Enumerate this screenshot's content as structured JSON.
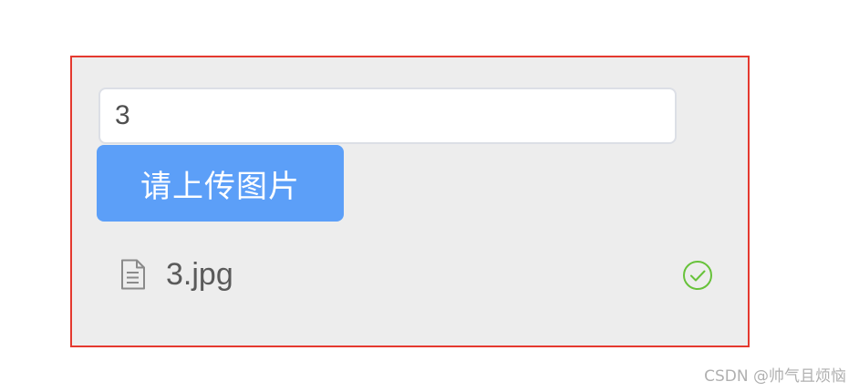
{
  "form": {
    "text_value": "3",
    "upload_button_label": "请上传图片",
    "file_list": [
      {
        "name": "3.jpg",
        "status_icon": "check-circle-icon",
        "status_color": "#67c23a"
      }
    ]
  },
  "watermark": "CSDN @帅气且烦恼",
  "colors": {
    "frame_border": "#e4392f",
    "frame_background": "#ededed",
    "button_background": "#5c9ff8"
  }
}
